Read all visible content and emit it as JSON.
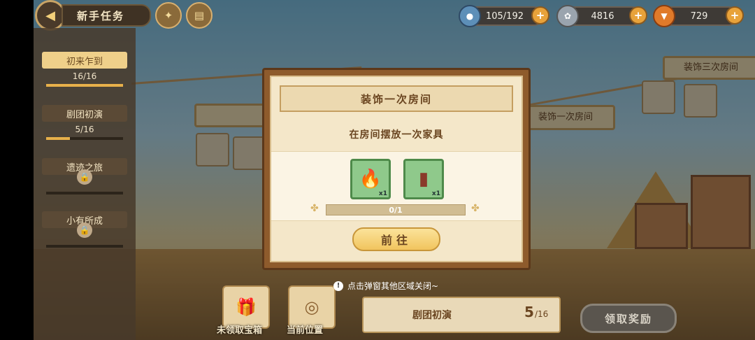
{
  "header": {
    "title": "新手任务",
    "back_icon": "back-arrow-icon",
    "icons": [
      "clover-icon",
      "compass-icon",
      "book-icon"
    ]
  },
  "resources": [
    {
      "name": "energy",
      "icon": "potion-icon",
      "value": "105/192"
    },
    {
      "name": "coins",
      "icon": "coin-icon",
      "value": "4816"
    },
    {
      "name": "carrots",
      "icon": "carrot-icon",
      "value": "729"
    }
  ],
  "sidebar": {
    "items": [
      {
        "label": "初来乍到",
        "progress": "16/16",
        "fill": 1.0,
        "active": true,
        "locked": false
      },
      {
        "label": "剧团初演",
        "progress": "5/16",
        "fill": 0.31,
        "active": false,
        "locked": false
      },
      {
        "label": "遗迹之旅",
        "progress": "",
        "fill": 0,
        "active": false,
        "locked": true
      },
      {
        "label": "小有所成",
        "progress": "",
        "fill": 0,
        "active": false,
        "locked": true
      }
    ]
  },
  "background": {
    "cards": [
      "装饰三次房间",
      "装饰一次房间"
    ]
  },
  "dialog": {
    "title": "装饰一次房间",
    "description": "在房间摆放一次家具",
    "rewards": [
      {
        "icon": "torch-icon",
        "qty": "x1"
      },
      {
        "icon": "totem-icon",
        "qty": "x1"
      }
    ],
    "progress_text": "0/1",
    "progress_value": 0,
    "button_label": "前往"
  },
  "hint": {
    "text": "点击弹窗其他区域关闭~"
  },
  "bottom": {
    "chest_label": "未领取宝箱",
    "location_label": "当前位置",
    "stage_name": "剧团初演",
    "stage_progress": "5",
    "stage_total": "/16",
    "claim_label": "领取奖励"
  },
  "colors": {
    "accent": "#f1c45e",
    "dialog_frame": "#8e5b2c",
    "reward_bg": "#8fc98b"
  }
}
